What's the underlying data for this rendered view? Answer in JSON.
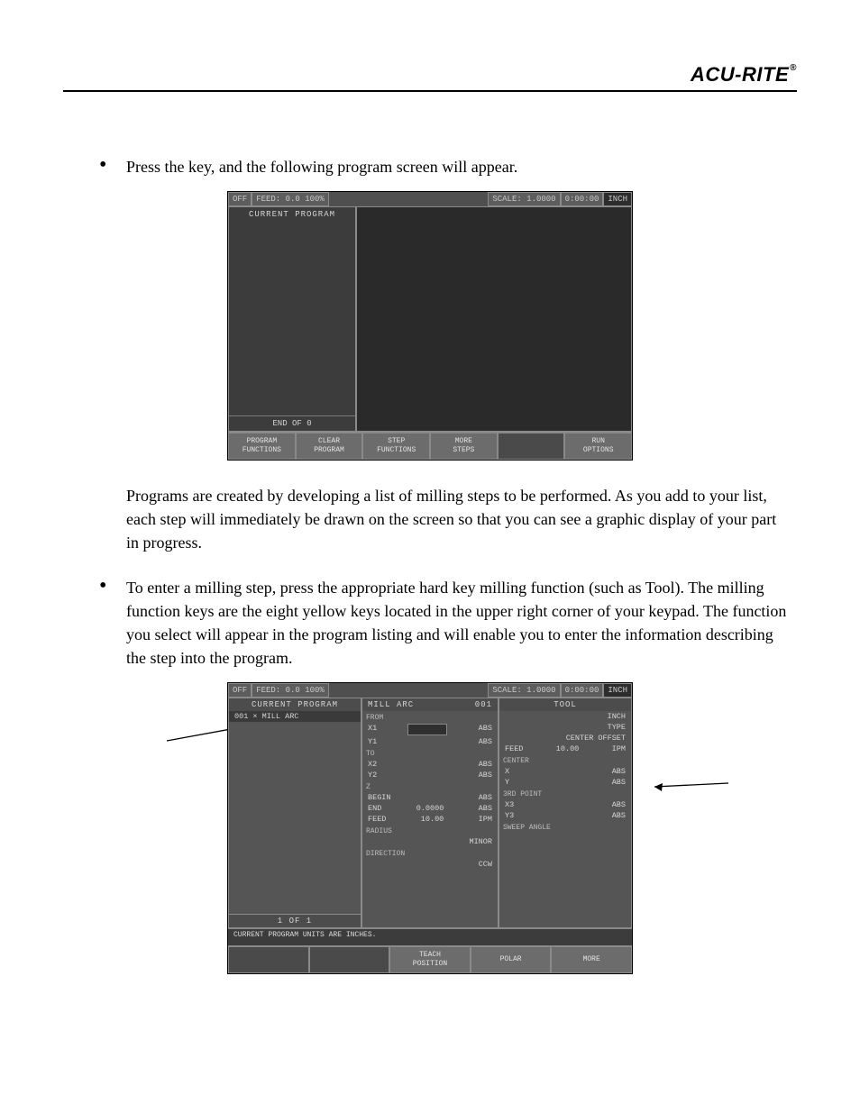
{
  "header": {
    "brand": "ACU-RITE",
    "reg": "®"
  },
  "body": {
    "bullet1": "Press the           key, and the following program screen will appear.",
    "para1": "Programs are created by developing a list of milling steps to be performed. As you add to your list, each step will immediately be drawn on the screen so that you can see a graphic display of your part in progress.",
    "bullet2": "To enter a milling step, press the appropriate hard key milling function (such as Tool). The milling function keys are the eight yellow keys located in the upper right corner of your keypad. The function you select will appear in the program listing and will enable you to enter the information describing the step into the program."
  },
  "shot1": {
    "status": {
      "off": "OFF",
      "feed": "FEED:    0.0 100%",
      "scale": "SCALE: 1.0000",
      "time": "0:00:00",
      "unit": "INCH"
    },
    "left_title": "CURRENT PROGRAM",
    "end": "END OF 0",
    "softkeys": {
      "k1a": "PROGRAM",
      "k1b": "FUNCTIONS",
      "k2a": "CLEAR",
      "k2b": "PROGRAM",
      "k3a": "STEP",
      "k3b": "FUNCTIONS",
      "k4a": "MORE",
      "k4b": "STEPS",
      "k5": "",
      "k6a": "RUN",
      "k6b": "OPTIONS"
    }
  },
  "shot2": {
    "status": {
      "off": "OFF",
      "feed": "FEED:    0.0 100%",
      "scale": "SCALE: 1.0000",
      "time": "0:00:00",
      "unit": "INCH"
    },
    "left_title": "CURRENT PROGRAM",
    "left_item": "001 × MILL ARC",
    "left_footer": "1 OF 1",
    "mid_title": "MILL ARC",
    "mid_title_num": "001",
    "mid": {
      "from": "FROM",
      "x1": "X1",
      "x1abs": "ABS",
      "y1": "Y1",
      "y1abs": "ABS",
      "to": "TO",
      "x2": "X2",
      "x2abs": "ABS",
      "y2": "Y2",
      "y2abs": "ABS",
      "z": "Z",
      "begin": "BEGIN",
      "beginabs": "ABS",
      "end": "END",
      "endval": "0.0000",
      "endabs": "ABS",
      "feed": "FEED",
      "feedval": "10.00",
      "feedunit": "IPM",
      "radius": "RADIUS",
      "minor": "MINOR",
      "direction": "DIRECTION",
      "ccw": "CCW"
    },
    "right_title": "TOOL",
    "right": {
      "inch": "INCH",
      "type": "TYPE",
      "offset": "CENTER  OFFSET",
      "feed": "FEED",
      "feedval": "10.00",
      "feedunit": "IPM",
      "center": "CENTER",
      "x": "X",
      "xabs": "ABS",
      "y": "Y",
      "yabs": "ABS",
      "tp": "3RD POINT",
      "x3": "X3",
      "x3abs": "ABS",
      "y3": "Y3",
      "y3abs": "ABS",
      "sweep": "SWEEP ANGLE"
    },
    "message": "CURRENT PROGRAM UNITS ARE INCHES.",
    "softkeys": {
      "k1": "",
      "k2": "",
      "k3a": "TEACH",
      "k3b": "POSITION",
      "k4": "POLAR",
      "k5": "MORE"
    }
  }
}
